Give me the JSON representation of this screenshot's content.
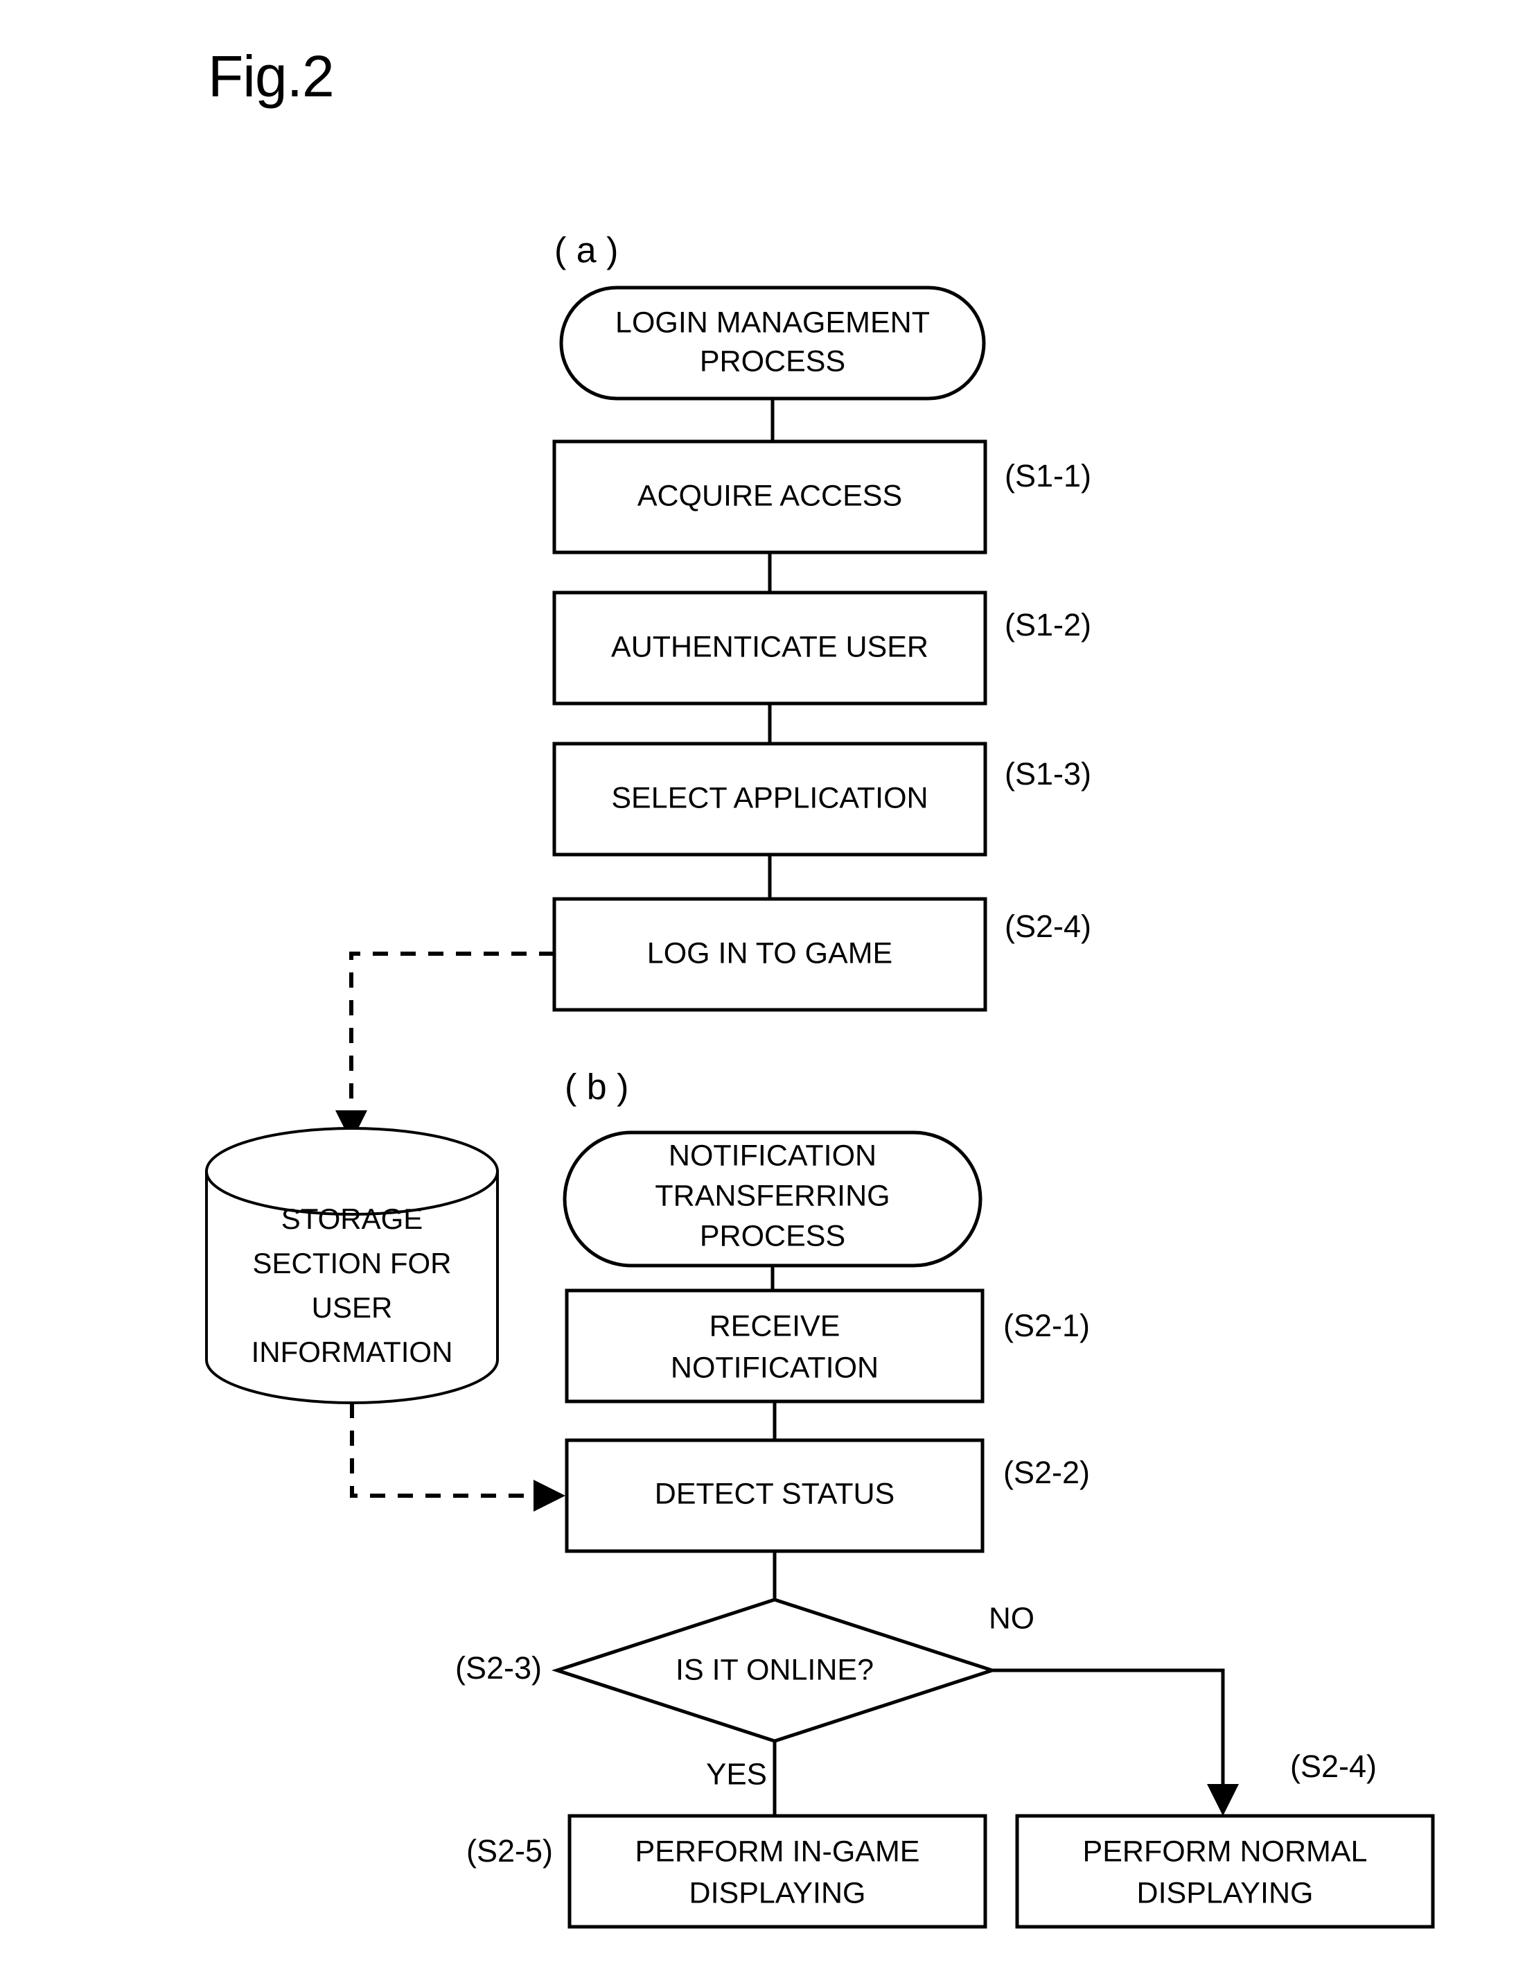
{
  "figure": {
    "title": "Fig.2"
  },
  "sections": {
    "a": {
      "tag": "( a )",
      "terminator": {
        "line1": "LOGIN MANAGEMENT",
        "line2": "PROCESS"
      },
      "steps": [
        {
          "label": "ACQUIRE ACCESS",
          "tag": "(S1-1)"
        },
        {
          "label": "AUTHENTICATE USER",
          "tag": "(S1-2)"
        },
        {
          "label": "SELECT APPLICATION",
          "tag": "(S1-3)"
        },
        {
          "label": "LOG IN TO GAME",
          "tag": "(S2-4)"
        }
      ]
    },
    "b": {
      "tag": "( b )",
      "terminator": {
        "line1": "NOTIFICATION",
        "line2": "TRANSFERRING",
        "line3": "PROCESS"
      },
      "steps": [
        {
          "label_line1": "RECEIVE",
          "label_line2": "NOTIFICATION",
          "tag": "(S2-1)"
        },
        {
          "label_line1": "DETECT STATUS",
          "label_line2": "",
          "tag": "(S2-2)"
        }
      ],
      "decision": {
        "label": "IS IT ONLINE?",
        "tag": "(S2-3)",
        "yes_label": "YES",
        "no_label": "NO"
      },
      "outcomes": [
        {
          "line1": "PERFORM IN-GAME",
          "line2": "DISPLAYING",
          "tag": "(S2-5)"
        },
        {
          "line1": "PERFORM NORMAL",
          "line2": "DISPLAYING",
          "tag": "(S2-4)"
        }
      ]
    }
  },
  "datastore": {
    "line1": "STORAGE",
    "line2": "SECTION FOR",
    "line3": "USER",
    "line4": "INFORMATION"
  },
  "colors": {
    "stroke": "#000000",
    "fill": "#ffffff",
    "background": "#ffffff"
  }
}
